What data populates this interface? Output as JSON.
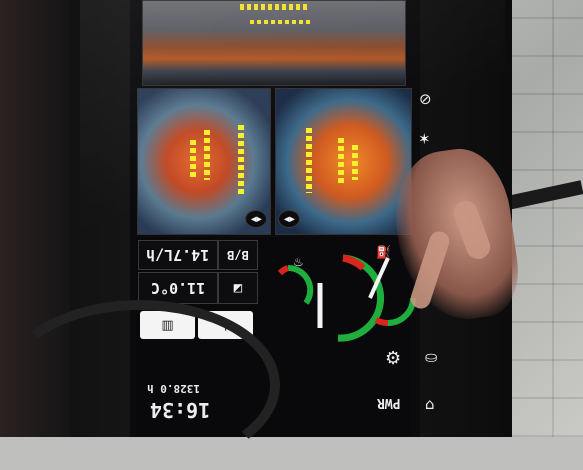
{
  "display": {
    "fuel_rate": "14.7L/h",
    "temperature": "11.0°C",
    "clock": "16:34",
    "hour_meter": "1328.0 h",
    "power_mode": "PWR",
    "fuel_mode_badge": "B/B",
    "camera_icon_left": "◀▶",
    "camera_icon_right": "◀▶"
  },
  "gauges": {
    "left_gauge_level": 0.55,
    "center_gauge_level": 0.5,
    "right_gauge_level": 0.4
  },
  "icons": {
    "engine_icon": "engine-icon",
    "coolant_icon": "coolant-icon",
    "work_light_icon": "work-light-icon",
    "wiper_icon": "wiper-icon",
    "oil_icon": "oil-can-icon",
    "seat_icon": "seat-icon",
    "lock_icon": "lock-icon",
    "attachment_icon": "attachment-icon"
  },
  "colors": {
    "accent_yellow": "#f3e12a",
    "gauge_green": "#1fae3e",
    "gauge_red": "#d8261f",
    "screen_bg": "#0b0b0d"
  }
}
